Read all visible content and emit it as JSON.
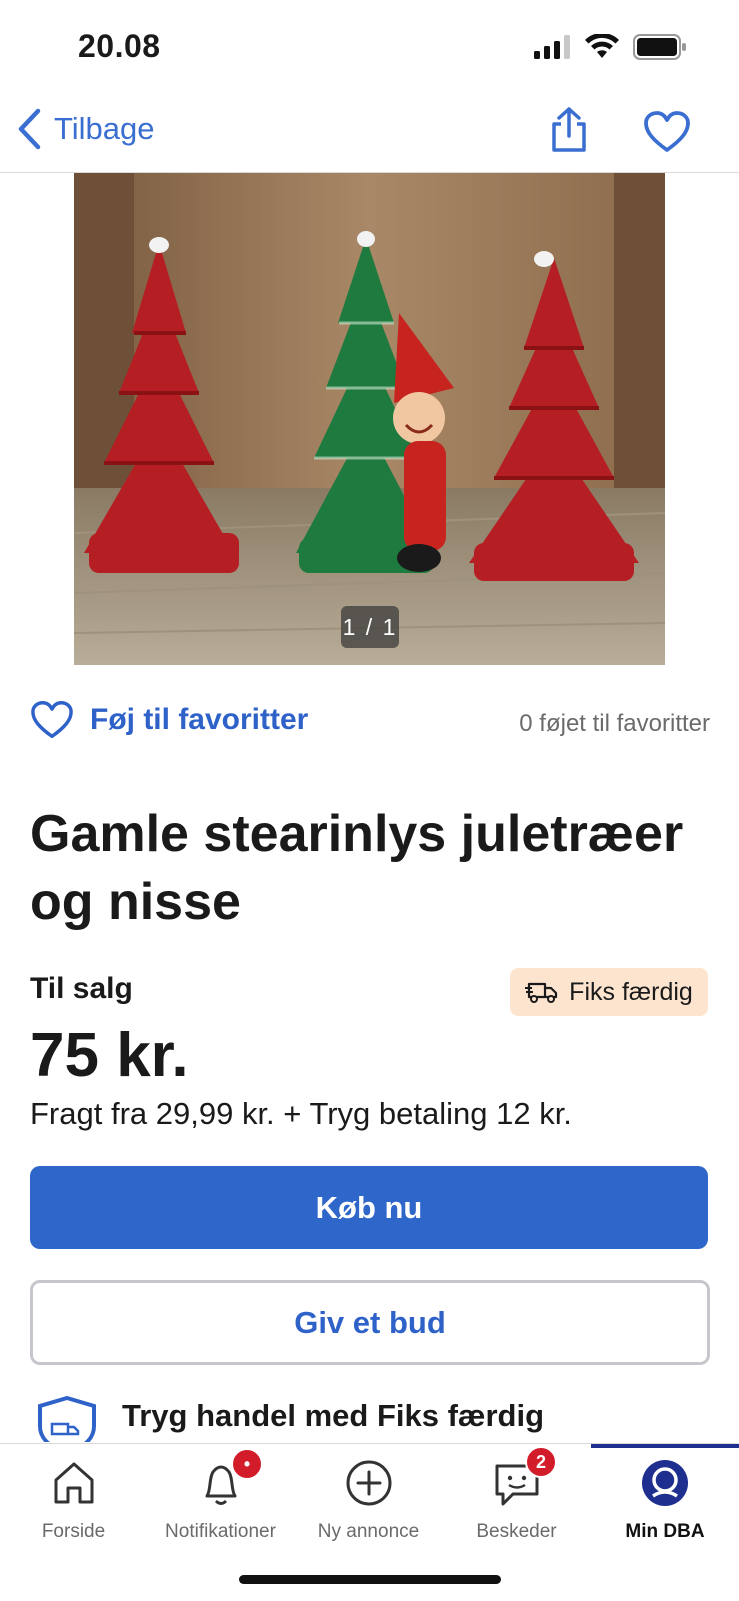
{
  "status_bar": {
    "time": "20.08",
    "icons": [
      "cellular-signal-icon",
      "wifi-icon",
      "battery-icon"
    ]
  },
  "nav": {
    "back_label": "Tilbage",
    "icons": [
      "chevron-left-icon",
      "share-icon",
      "heart-icon"
    ]
  },
  "gallery": {
    "counter": "1 / 1",
    "image_description": "photo-candles"
  },
  "favorites": {
    "button_label": "Føj til favoritter",
    "count_text": "0 føjet til favoritter"
  },
  "listing": {
    "title": "Gamle stearinlys juletræer og nisse",
    "sale_type": "Til salg",
    "shipping_badge": "Fiks færdig",
    "price": "75 kr.",
    "shipping_text": "Fragt fra 29,99 kr. + Tryg betaling 12 kr.",
    "buy_label": "Køb nu",
    "bid_label": "Giv et bud",
    "trust_heading": "Tryg handel med Fiks færdig"
  },
  "tabbar": {
    "items": [
      {
        "label": "Forside",
        "icon": "home-icon"
      },
      {
        "label": "Notifikationer",
        "icon": "bell-icon",
        "badge": "•"
      },
      {
        "label": "Ny annonce",
        "icon": "plus-circle-icon"
      },
      {
        "label": "Beskeder",
        "icon": "message-icon",
        "badge": "2"
      },
      {
        "label": "Min DBA",
        "icon": "profile-icon",
        "active": true
      }
    ]
  },
  "colors": {
    "accent": "#2f66c9",
    "badge_bg": "#fde4cf",
    "notification_red": "#d21c2a",
    "active_tab": "#1f2f8f"
  }
}
